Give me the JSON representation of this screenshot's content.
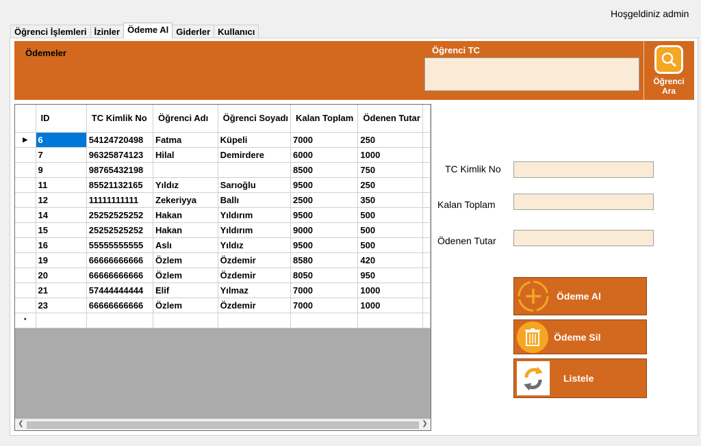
{
  "header": {
    "welcome": "Hoşgeldiniz  admin"
  },
  "tabs": [
    {
      "label": "Öğrenci İşlemleri"
    },
    {
      "label": "İzinler"
    },
    {
      "label": "Ödeme Al"
    },
    {
      "label": "Giderler"
    },
    {
      "label": "Kullanıcı"
    }
  ],
  "panel": {
    "title": "Ödemeler",
    "tc_label": "Öğrenci TC",
    "tc_value": "",
    "search_label": "Öğrenci Ara",
    "search_icon": "magnifier-icon"
  },
  "grid": {
    "columns": [
      "ID",
      "TC Kimlik No",
      "Öğrenci Adı",
      "Öğrenci Soyadı",
      "Kalan Toplam",
      "Ödenen Tutar"
    ],
    "rows": [
      [
        "6",
        "54124720498",
        "Fatma",
        "Küpeli",
        "7000",
        "250"
      ],
      [
        "7",
        "96325874123",
        "Hilal",
        "Demirdere",
        "6000",
        "1000"
      ],
      [
        "9",
        "98765432198",
        "",
        "",
        "8500",
        "750"
      ],
      [
        "11",
        "85521132165",
        "Yıldız",
        "Sarıoğlu",
        "9500",
        "250"
      ],
      [
        "12",
        "11111111111",
        "Zekeriyya",
        "Ballı",
        "2500",
        "350"
      ],
      [
        "14",
        "25252525252",
        "Hakan",
        "Yıldırım",
        "9500",
        "500"
      ],
      [
        "15",
        "25252525252",
        "Hakan",
        "Yıldırım",
        "9000",
        "500"
      ],
      [
        "16",
        "55555555555",
        "Aslı",
        "Yıldız",
        "9500",
        "500"
      ],
      [
        "19",
        "66666666666",
        "Özlem",
        "Özdemir",
        "8580",
        "420"
      ],
      [
        "20",
        "66666666666",
        "Özlem",
        "Özdemir",
        "8050",
        "950"
      ],
      [
        "21",
        "57444444444",
        "Elif",
        "Yılmaz",
        "7000",
        "1000"
      ],
      [
        "23",
        "66666666666",
        "Özlem",
        "Özdemir",
        "7000",
        "1000"
      ]
    ],
    "selected_row": 0,
    "current_marker": "▶",
    "new_row_marker": "*"
  },
  "form": {
    "tc_label": "TC Kimlik No",
    "tc_value": "",
    "kalan_label": "Kalan Toplam",
    "kalan_value": "",
    "odenen_label": "Ödenen Tutar",
    "odenen_value": ""
  },
  "actions": {
    "odeme_al": "Ödeme Al",
    "odeme_sil": "Ödeme Sil",
    "listele": "Listele"
  },
  "colors": {
    "accent": "#d2691e",
    "input_bg": "#faebd7",
    "selection": "#0078d7"
  }
}
